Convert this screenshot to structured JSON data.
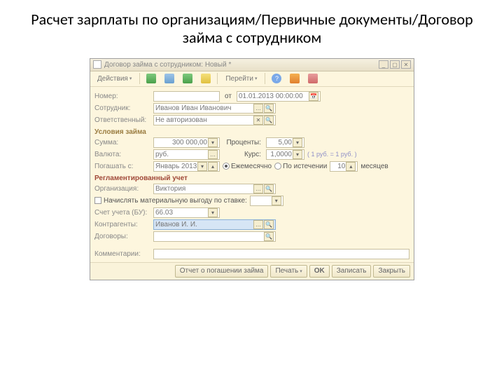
{
  "page_heading": "Расчет зарплаты по организациям/Первичные документы/Договор займа с сотрудником",
  "window": {
    "title": "Договор займа с сотрудником: Новый *"
  },
  "toolbar": {
    "actions": "Действия",
    "goto": "Перейти"
  },
  "form": {
    "number_label": "Номер:",
    "number_value": "",
    "date_label": "от",
    "date_value": "01.01.2013 00:00:00",
    "employee_label": "Сотрудник:",
    "employee_value": "Иванов Иван Иванович",
    "responsible_label": "Ответственный:",
    "responsible_value": "Не авторизован"
  },
  "terms": {
    "title": "Условия займа",
    "sum_label": "Сумма:",
    "sum_value": "300 000,00",
    "percent_label": "Проценты:",
    "percent_value": "5,00",
    "currency_label": "Валюта:",
    "currency_value": "руб.",
    "rate_label": "Курс:",
    "rate_value": "1,0000",
    "rate_note": "( 1 руб. = 1 руб. )",
    "repay_label": "Погашать с:",
    "repay_value": "Январь 2013",
    "period_monthly": "Ежемесячно",
    "period_at_end": "По истечении",
    "months_value": "10",
    "months_label": "месяцев"
  },
  "regl": {
    "title": "Регламентированный учет",
    "org_label": "Организация:",
    "org_value": "Виктория",
    "tax_check": "Начислять материальную выгоду по ставке:",
    "acc_label": "Счет учета (БУ):",
    "acc_value": "66.03",
    "contr_label": "Контрагенты:",
    "contr_value": "Иванов И. И.",
    "dog_label": "Договоры:",
    "dog_value": ""
  },
  "comment_label": "Комментарии:",
  "comment_value": "",
  "footer": {
    "report": "Отчет о погашении займа",
    "print": "Печать",
    "ok": "OK",
    "save": "Записать",
    "close": "Закрыть"
  }
}
